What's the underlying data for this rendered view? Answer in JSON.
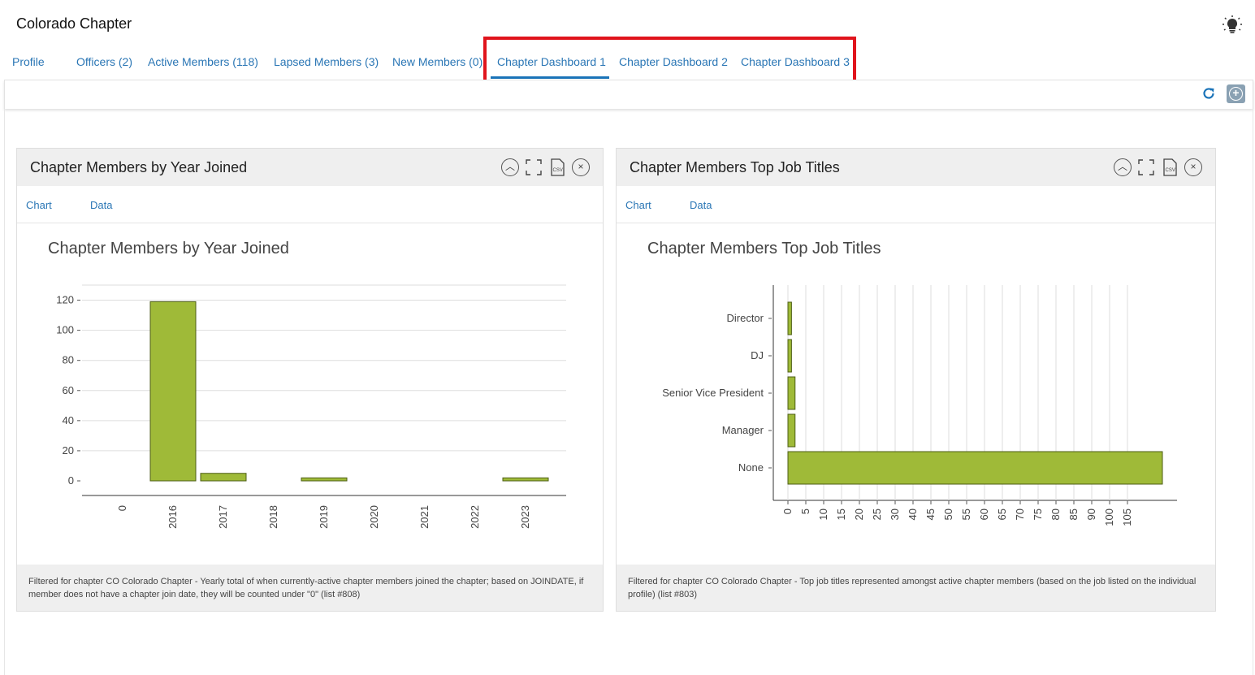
{
  "page": {
    "title": "Colorado Chapter"
  },
  "tabs": [
    {
      "label": "Profile"
    },
    {
      "label": "Officers (2)"
    },
    {
      "label": "Active Members (118)"
    },
    {
      "label": "Lapsed Members (3)"
    },
    {
      "label": "New Members (0)"
    },
    {
      "label": "Chapter Dashboard 1"
    },
    {
      "label": "Chapter Dashboard 2"
    },
    {
      "label": "Chapter Dashboard 3"
    }
  ],
  "active_tab": "Chapter Dashboard 1",
  "icons": {
    "header": "lightbulb-icon",
    "toolbar": [
      "refresh-icon",
      "add-widget-icon"
    ],
    "panel_tools": [
      "collapse-icon",
      "expand-icon",
      "csv-export-icon",
      "close-icon"
    ]
  },
  "colors": {
    "accent": "#2a76b5",
    "bar": "#9fba38",
    "bar_border": "#4d5e14",
    "highlight": "#e0141c"
  },
  "panels": [
    {
      "title": "Chapter Members by Year Joined",
      "subtabs": [
        "Chart",
        "Data"
      ],
      "chart_title": "Chapter Members by Year Joined",
      "footer": "Filtered for chapter CO Colorado Chapter - Yearly total of when currently-active chapter members joined the chapter; based on JOINDATE, if member does not have a chapter join date, they will be counted under \"0\" (list #808)"
    },
    {
      "title": "Chapter Members Top Job Titles",
      "subtabs": [
        "Chart",
        "Data"
      ],
      "chart_title": "Chapter Members Top Job Titles",
      "footer": "Filtered for chapter CO Colorado Chapter - Top job titles represented amongst active chapter members (based on the job listed on the individual profile) (list #803)"
    }
  ],
  "chart_data": [
    {
      "type": "bar",
      "title": "Chapter Members by Year Joined",
      "categories": [
        "0",
        "2016",
        "2017",
        "2018",
        "2019",
        "2020",
        "2021",
        "2022",
        "2023"
      ],
      "values": [
        0,
        119,
        5,
        0,
        2,
        0,
        0,
        0,
        2
      ],
      "y_ticks": [
        0,
        20,
        40,
        60,
        80,
        100,
        120
      ],
      "ylim": [
        0,
        130
      ],
      "grid": true
    },
    {
      "type": "bar",
      "orientation": "horizontal",
      "title": "Chapter Members Top Job Titles",
      "categories": [
        "Director",
        "DJ",
        "Senior Vice President",
        "Manager",
        "None"
      ],
      "values": [
        1,
        1,
        2,
        2,
        105
      ],
      "x_ticks": [
        0,
        5,
        10,
        15,
        20,
        25,
        30,
        40,
        45,
        50,
        55,
        60,
        65,
        70,
        75,
        80,
        85,
        90,
        100,
        105
      ],
      "xlim": [
        0,
        105
      ],
      "grid": true
    }
  ]
}
